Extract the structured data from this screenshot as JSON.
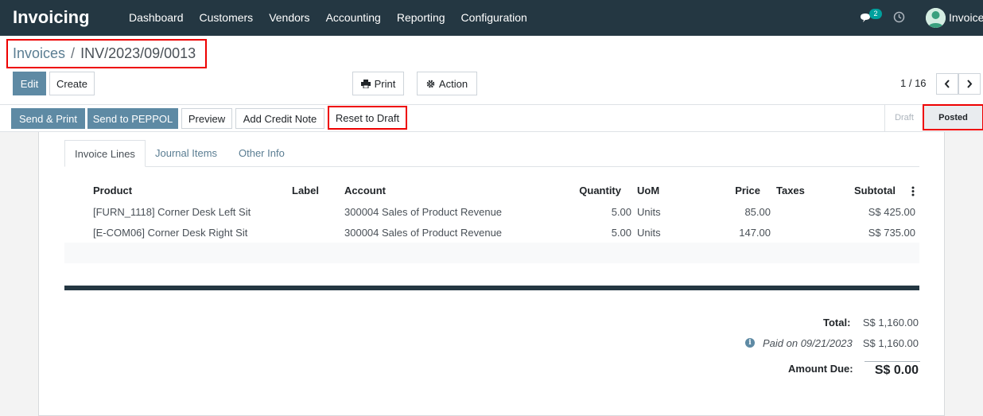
{
  "navbar": {
    "brand": "Invoicing",
    "menu": [
      "Dashboard",
      "Customers",
      "Vendors",
      "Accounting",
      "Reporting",
      "Configuration"
    ],
    "chat_badge": "2",
    "user": "Invoice",
    "icons": [
      "chat-icon",
      "clock-icon",
      "user-avatar"
    ]
  },
  "breadcrumb": {
    "parent": "Invoices",
    "separator": "/",
    "current": "INV/2023/09/0013"
  },
  "toolbar": {
    "edit": "Edit",
    "create": "Create",
    "print": "Print",
    "action": "Action"
  },
  "pager": {
    "value": "1 / 16"
  },
  "statusbar": {
    "send_print": "Send & Print",
    "send_peppol": "Send to PEPPOL",
    "preview": "Preview",
    "add_credit_note": "Add Credit Note",
    "reset_to_draft": "Reset to Draft",
    "stages": [
      "Draft",
      "Posted"
    ],
    "active_stage": "Posted"
  },
  "tabs": [
    "Invoice Lines",
    "Journal Items",
    "Other Info"
  ],
  "lines": {
    "headers": {
      "product": "Product",
      "label": "Label",
      "account": "Account",
      "quantity": "Quantity",
      "uom": "UoM",
      "price": "Price",
      "taxes": "Taxes",
      "subtotal": "Subtotal"
    },
    "rows": [
      {
        "product": "[FURN_1118] Corner Desk Left Sit",
        "label": "",
        "account": "300004 Sales of Product Revenue",
        "quantity": "5.00",
        "uom": "Units",
        "price": "85.00",
        "taxes": "",
        "subtotal": "S$ 425.00"
      },
      {
        "product": "[E-COM06] Corner Desk Right Sit",
        "label": "",
        "account": "300004 Sales of Product Revenue",
        "quantity": "5.00",
        "uom": "Units",
        "price": "147.00",
        "taxes": "",
        "subtotal": "S$ 735.00"
      }
    ]
  },
  "totals": {
    "total_label": "Total:",
    "total_value": "S$ 1,160.00",
    "paid_label": "Paid on 09/21/2023",
    "paid_value": "S$ 1,160.00",
    "due_label": "Amount Due:",
    "due_value": "S$ 0.00"
  },
  "colors": {
    "navbar": "#243742",
    "primary": "#5e8aa4",
    "highlight": "#ee0000"
  }
}
